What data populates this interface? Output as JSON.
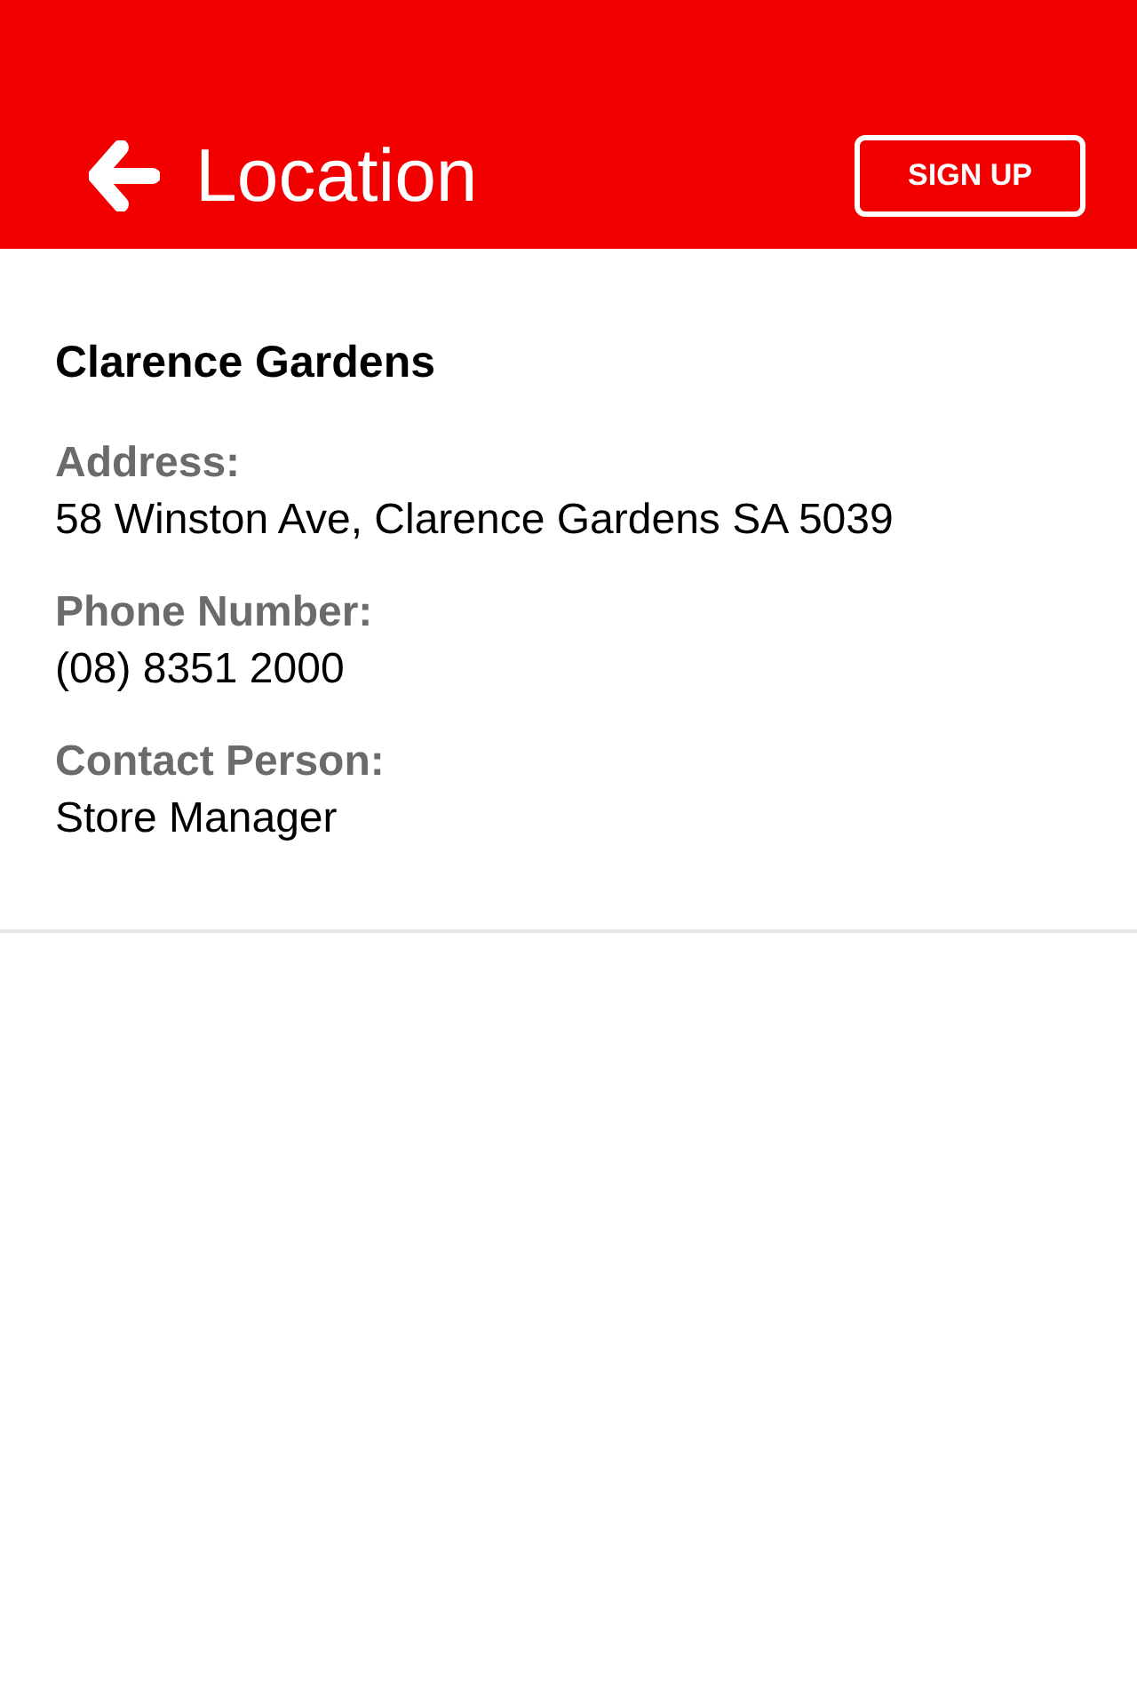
{
  "header": {
    "title": "Location",
    "action": "SIGN UP"
  },
  "location": {
    "name": "Clarence Gardens",
    "fields": [
      {
        "label": "Address:",
        "value": "58 Winston Ave, Clarence Gardens SA 5039"
      },
      {
        "label": "Phone Number:",
        "value": "(08) 8351 2000"
      },
      {
        "label": "Contact Person:",
        "value": "Store Manager"
      }
    ]
  }
}
